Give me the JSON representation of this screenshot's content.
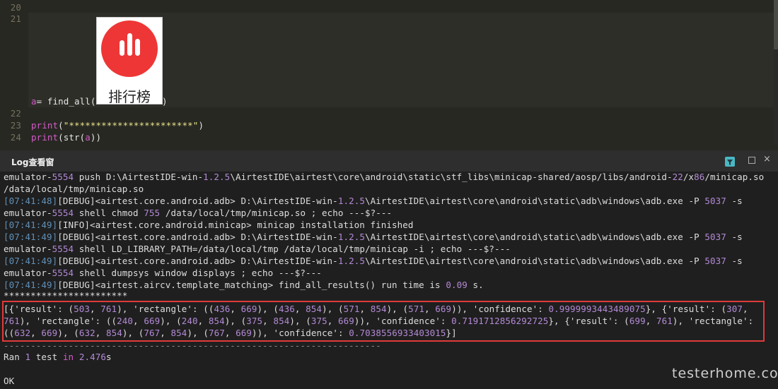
{
  "editor": {
    "line_numbers": [
      "20",
      "21",
      "22",
      "23",
      "24"
    ],
    "line21_var": "a",
    "line21_eq": "= ",
    "line21_fn": "find_all(",
    "line21_close": ")",
    "line23_fn": "print",
    "line23_open": "(",
    "line23_str": "\"***********************\"",
    "line23_close": ")",
    "line24_fn": "print",
    "line24_open": "(str(",
    "line24_var": "a",
    "line24_close": "))",
    "thumbnail_label": "排行榜"
  },
  "panel": {
    "title": "Log查看窗",
    "filter_icon": "filter-icon",
    "restore_icon": "restore-icon",
    "close_icon": "close-icon",
    "close_glyph": "×"
  },
  "log": {
    "l1a": "emulator-",
    "l1b": "5554",
    "l1c": " push D:\\AirtestIDE-win-",
    "l1d": "1.2.5",
    "l1e": "\\AirtestIDE\\airtest\\core\\android\\static\\stf_libs\\minicap-shared/aosp/libs/android-",
    "l1f": "22",
    "l1g": "/x",
    "l1h": "86",
    "l1i": "/minicap.so",
    "l2": "/data/local/tmp/minicap.so",
    "l3ts": "[07:41:48]",
    "l3a": "[DEBUG]<airtest.core.android.adb> D:\\AirtestIDE-win-",
    "l3b": "1.2.5",
    "l3c": "\\AirtestIDE\\airtest\\core\\android\\static\\adb\\windows\\adb.exe -P ",
    "l3d": "5037",
    "l3e": " -s",
    "l4a": "emulator-",
    "l4b": "5554",
    "l4c": " shell chmod ",
    "l4d": "755",
    "l4e": " /data/local/tmp/minicap.so ; echo ---$?---",
    "l5ts": "[07:41:49]",
    "l5a": "[INFO]<airtest.core.android.minicap> minicap installation finished",
    "l6ts": "[07:41:49]",
    "l6a": "[DEBUG]<airtest.core.android.adb> D:\\AirtestIDE-win-",
    "l6b": "1.2.5",
    "l6c": "\\AirtestIDE\\airtest\\core\\android\\static\\adb\\windows\\adb.exe -P ",
    "l6d": "5037",
    "l6e": " -s",
    "l7a": "emulator-",
    "l7b": "5554",
    "l7c": " shell LD_LIBRARY_PATH=/data/local/tmp /data/local/tmp/minicap -i ; echo ---$?---",
    "l8ts": "[07:41:49]",
    "l8a": "[DEBUG]<airtest.core.android.adb> D:\\AirtestIDE-win-",
    "l8b": "1.2.5",
    "l8c": "\\AirtestIDE\\airtest\\core\\android\\static\\adb\\windows\\adb.exe -P ",
    "l8d": "5037",
    "l8e": " -s",
    "l9a": "emulator-",
    "l9b": "5554",
    "l9c": " shell dumpsys window displays ; echo ---$?---",
    "l10ts": "[07:41:49]",
    "l10a": "[DEBUG]<airtest.aircv.template_matching> find_all_results() run time is ",
    "l10b": "0.09",
    "l10c": " s.",
    "l11": "***********************",
    "r1a": "[{'result': (",
    "r1b": "503",
    "r1c": ", ",
    "r1d": "761",
    "r1e": "), 'rectangle': ((",
    "r1f": "436",
    "r1g": ", ",
    "r1h": "669",
    "r1i": "), (",
    "r1j": "436",
    "r1k": ", ",
    "r1l": "854",
    "r1m": "), (",
    "r1n": "571",
    "r1o": ", ",
    "r1p": "854",
    "r1q": "), (",
    "r1r": "571",
    "r1s": ", ",
    "r1t": "669",
    "r1u": ")), 'confidence': ",
    "r1v": "0.9999993443489075",
    "r1w": "}, {'result': (",
    "r1x": "307",
    "r1y": ",",
    "r2a": "761",
    "r2b": "), 'rectangle': ((",
    "r2c": "240",
    "r2d": ", ",
    "r2e": "669",
    "r2f": "), (",
    "r2g": "240",
    "r2h": ", ",
    "r2i": "854",
    "r2j": "), (",
    "r2k": "375",
    "r2l": ", ",
    "r2m": "854",
    "r2n": "), (",
    "r2o": "375",
    "r2p": ", ",
    "r2q": "669",
    "r2r": ")), 'confidence': ",
    "r2s": "0.7191712856292725",
    "r2t": "}, {'result': (",
    "r2u": "699",
    "r2v": ", ",
    "r2w": "761",
    "r2x": "), 'rectangle':",
    "r3a": "((",
    "r3b": "632",
    "r3c": ", ",
    "r3d": "669",
    "r3e": "), (",
    "r3f": "632",
    "r3g": ", ",
    "r3h": "854",
    "r3i": "), (",
    "r3j": "767",
    "r3k": ", ",
    "r3l": "854",
    "r3m": "), (",
    "r3n": "767",
    "r3o": ", ",
    "r3p": "669",
    "r3q": ")), 'confidence': ",
    "r3r": "0.7038556933403015",
    "r3s": "}]",
    "dashes": "----------------------------------------------------------------------",
    "ran_a": "Ran ",
    "ran_b": "1",
    "ran_c": " test ",
    "ran_d": "in",
    "ran_e": " ",
    "ran_f": "2.476",
    "ran_g": "s",
    "ok": "OK"
  },
  "watermark": "testerhome.com",
  "colors": {
    "editor_bg": "#272822",
    "log_bg": "#1f1f1f",
    "timestamp": "#6090b8",
    "number": "#b38ad6",
    "highlight_border": "#e03a3a",
    "thumbnail_red": "#ee3636"
  }
}
